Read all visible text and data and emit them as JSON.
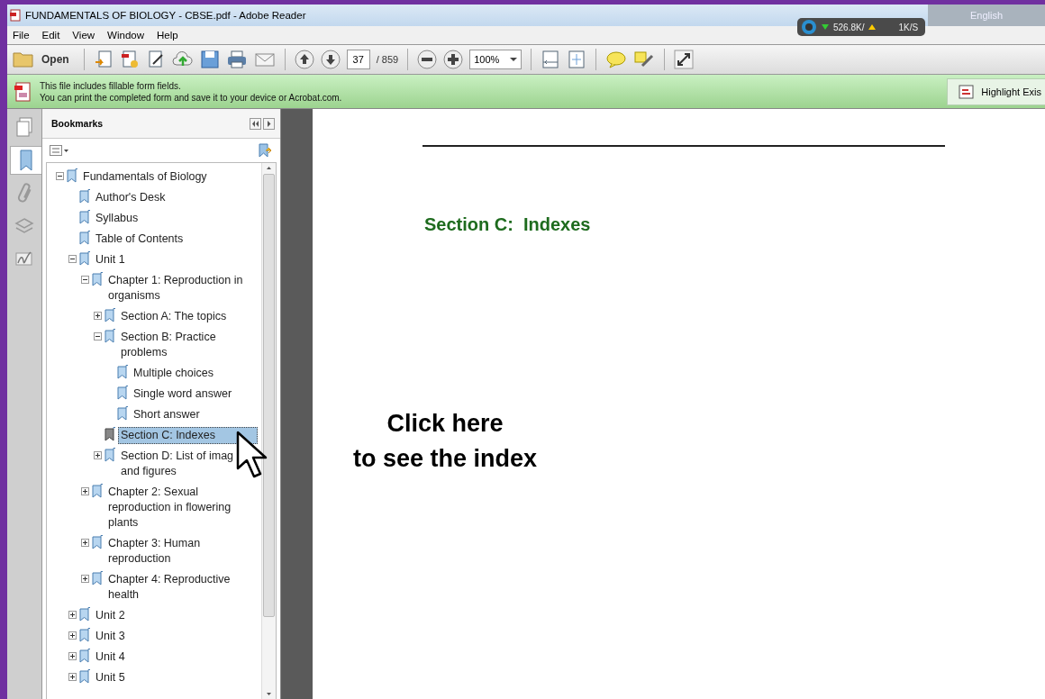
{
  "window": {
    "title": "FUNDAMENTALS OF BIOLOGY - CBSE.pdf - Adobe Reader"
  },
  "net_meter": {
    "down": "526.8K/",
    "up": "1K/S"
  },
  "language_bar": {
    "language": "English"
  },
  "menu": [
    "File",
    "Edit",
    "View",
    "Window",
    "Help"
  ],
  "toolbar": {
    "open_label": "Open",
    "page": "37",
    "page_count": "/ 859",
    "zoom": "100%"
  },
  "form_notice": {
    "lines": [
      "This file includes fillable form fields.",
      "You can print the completed form and save it to your device or Acrobat.com."
    ],
    "button": "Highlight Exis"
  },
  "side_tabs": [
    {
      "kind": "pages",
      "selected": false
    },
    {
      "kind": "bookmarks",
      "selected": true
    },
    {
      "kind": "attachments",
      "selected": false
    },
    {
      "kind": "layers",
      "selected": false
    },
    {
      "kind": "signatures",
      "selected": false
    }
  ],
  "bookmarks": {
    "title": "Bookmarks",
    "items": [
      {
        "label": "Fundamentals of Biology",
        "selected": false,
        "expanded": true,
        "children": [
          {
            "label": "Author's Desk",
            "selected": false
          },
          {
            "label": "Syllabus",
            "selected": false
          },
          {
            "label": "Table of Contents",
            "selected": false
          },
          {
            "label": "Unit 1",
            "selected": false,
            "expanded": true,
            "children": [
              {
                "label": "Chapter 1: Reproduction in organisms",
                "selected": false,
                "expanded": true,
                "children": [
                  {
                    "label": "Section A: The topics",
                    "selected": false,
                    "expanded": false
                  },
                  {
                    "label": "Section B: Practice problems",
                    "selected": false,
                    "expanded": true,
                    "children": [
                      {
                        "label": "Multiple choices",
                        "selected": false
                      },
                      {
                        "label": "Single word answer",
                        "selected": false
                      },
                      {
                        "label": "Short answer",
                        "selected": false
                      }
                    ]
                  },
                  {
                    "label": "Section C: Indexes",
                    "selected": true
                  },
                  {
                    "label": "Section D: List of imag and figures",
                    "selected": false,
                    "expanded": false
                  }
                ]
              },
              {
                "label": "Chapter 2: Sexual reproduction in flowering plants",
                "selected": false,
                "expanded": false
              },
              {
                "label": "Chapter 3: Human reproduction",
                "selected": false,
                "expanded": false
              },
              {
                "label": "Chapter 4: Reproductive health",
                "selected": false,
                "expanded": false
              }
            ]
          },
          {
            "label": "Unit 2",
            "selected": false,
            "expanded": false
          },
          {
            "label": "Unit 3",
            "selected": false,
            "expanded": false
          },
          {
            "label": "Unit 4",
            "selected": false,
            "expanded": false
          },
          {
            "label": "Unit 5",
            "selected": false,
            "expanded": false
          }
        ]
      }
    ]
  },
  "page": {
    "heading": "Section C:  Indexes"
  },
  "annotation": {
    "lines": [
      "Click here",
      "to see the index"
    ]
  }
}
